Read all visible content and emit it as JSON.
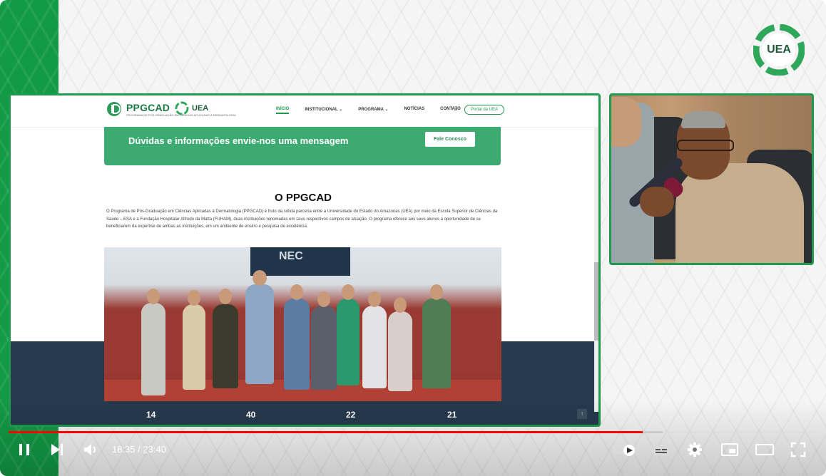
{
  "player": {
    "time_current": "18:35",
    "time_total": "23:40",
    "time_separator": " / ",
    "progress": 0.785,
    "buffered": 0.81
  },
  "logo": {
    "text": "UEA"
  },
  "site": {
    "brand": "PPGCAD",
    "brand_sub": "PROGRAMA DE PÓS-GRADUAÇÃO EM CIÊNCIAS APLICADAS À DERMATOLOGIA",
    "uea_label": "UEA",
    "nav": [
      "INÍCIO",
      "INSTITUCIONAL",
      "PROGRAMA",
      "NOTÍCIAS",
      "CONTATO"
    ],
    "portal": "Portal da UEA",
    "banner_text": "Dúvidas e informações envie-nos uma mensagem",
    "banner_button": "Fale Conosco",
    "about_title": "O PPGCAD",
    "about_text": "O Programa de Pós-Graduação em Ciências Aplicadas à Dermatologia (PPGCAD) é fruto da sólida parceria entre a Universidade do Estado do Amazonas (UEA) por meio da Escola Superior de Ciências da Saúde – ESA e a Fundação Hospitalar Alfredo da Matta (FUHAM), duas instituições renomadas em seus respectivos campos de atuação. O programa oferece aos seus alunos a oportunidade de se beneficiarem da expertise de ambas as instituições, em um ambiente de ensino e pesquisa de excelência.",
    "photo_screen": "NEC",
    "stats": [
      "14",
      "40",
      "22",
      "21"
    ],
    "to_top": "↑"
  },
  "colors": {
    "accent": "#1f9a4e",
    "progress": "#ff0000"
  },
  "icons": [
    "pause-icon",
    "next-icon",
    "volume-icon",
    "autoplay-toggle-icon",
    "subtitles-icon",
    "settings-icon",
    "miniplayer-icon",
    "theater-icon",
    "fullscreen-icon"
  ]
}
